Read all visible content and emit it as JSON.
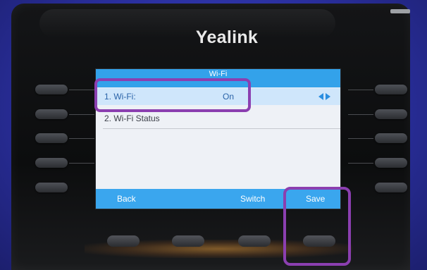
{
  "device": {
    "brand": "Yealink"
  },
  "screen": {
    "header_title": "Wi-Fi",
    "rows": [
      {
        "label": "1. Wi-Fi:",
        "value": "On"
      },
      {
        "label": "2. Wi-Fi Status",
        "value": ""
      }
    ],
    "softkeys": {
      "back": "Back",
      "switch": "Switch",
      "save": "Save"
    }
  },
  "annotations": {
    "highlight_color": "#8b3fb0"
  },
  "colors": {
    "screen_header": "#33a2ea",
    "softkey_bar": "#3aa6ee",
    "selected_row": "#cfe6fb"
  }
}
